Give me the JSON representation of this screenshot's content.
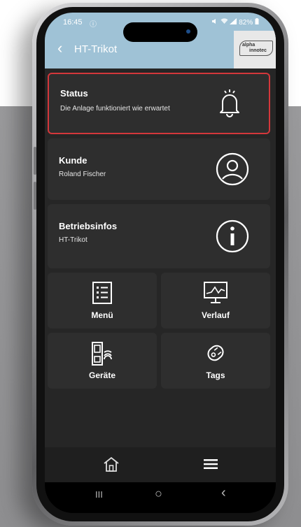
{
  "statusbar": {
    "time": "16:45",
    "info_glyph": "ⓘ",
    "battery": "82%"
  },
  "appbar": {
    "back_glyph": "‹",
    "title": "HT-Trikot",
    "logo_line1": "alpha",
    "logo_line2": "innotec"
  },
  "cards": {
    "status": {
      "title": "Status",
      "subtitle": "Die Anlage funktioniert wie erwartet",
      "icon": "bell-alert-icon",
      "highlight_color": "#d4373b"
    },
    "kunde": {
      "title": "Kunde",
      "subtitle": "Roland Fischer",
      "icon": "person-circle-icon"
    },
    "betrieb": {
      "title": "Betriebsinfos",
      "subtitle": "HT-Trikot",
      "icon": "info-circle-icon"
    }
  },
  "tiles": [
    {
      "label": "Menü",
      "icon": "list-document-icon"
    },
    {
      "label": "Verlauf",
      "icon": "monitor-chart-icon"
    },
    {
      "label": "Geräte",
      "icon": "device-wireless-icon"
    },
    {
      "label": "Tags",
      "icon": "tag-icon"
    }
  ],
  "bottom_nav": {
    "home_icon": "home-icon",
    "menu_icon": "hamburger-icon"
  },
  "system_nav": {
    "recents_glyph": "III",
    "home_glyph": "○",
    "back_glyph": "‹"
  },
  "colors": {
    "accent": "#9fc2d6",
    "card_bg": "#2e2e2e",
    "screen_bg": "#262626"
  }
}
